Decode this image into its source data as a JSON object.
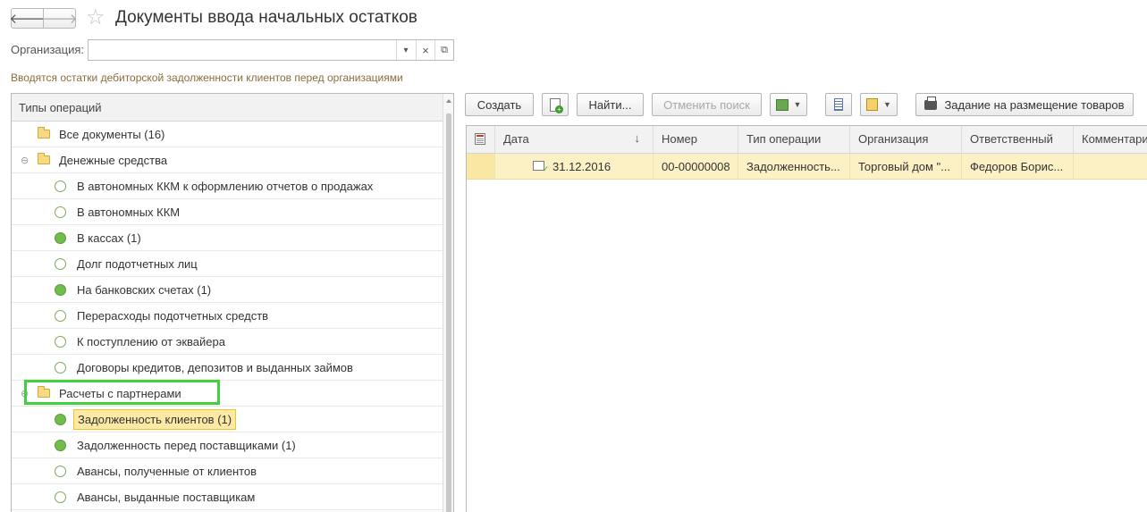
{
  "window": {
    "title": "Документы ввода начальных остатков"
  },
  "filter": {
    "organization_label": "Организация:",
    "organization_value": "",
    "dropdown_glyph": "▾",
    "clear_glyph": "×",
    "open_glyph": "⧉"
  },
  "hint": "Вводятся остатки дебиторской задолженности клиентов перед организациями",
  "tree": {
    "header": "Типы операций",
    "items": [
      {
        "label": "Все документы (16)",
        "kind": "folder",
        "level": 0
      },
      {
        "label": "Денежные средства",
        "kind": "folder",
        "level": 0,
        "expanded": true
      },
      {
        "label": "В автономных ККМ к оформлению отчетов о продажах",
        "kind": "leaf",
        "has_docs": false
      },
      {
        "label": "В автономных ККМ",
        "kind": "leaf",
        "has_docs": false
      },
      {
        "label": "В кассах (1)",
        "kind": "leaf",
        "has_docs": true
      },
      {
        "label": "Долг подотчетных лиц",
        "kind": "leaf",
        "has_docs": false
      },
      {
        "label": "На банковских счетах (1)",
        "kind": "leaf",
        "has_docs": true
      },
      {
        "label": "Перерасходы подотчетных средств",
        "kind": "leaf",
        "has_docs": false
      },
      {
        "label": "К поступлению от эквайера",
        "kind": "leaf",
        "has_docs": false
      },
      {
        "label": "Договоры кредитов, депозитов и выданных займов",
        "kind": "leaf",
        "has_docs": false
      },
      {
        "label": "Расчеты с партнерами",
        "kind": "folder",
        "level": 0,
        "expanded": true,
        "highlighted": true
      },
      {
        "label": "Задолженность клиентов (1)",
        "kind": "leaf",
        "has_docs": true,
        "selected": true
      },
      {
        "label": "Задолженность перед поставщиками (1)",
        "kind": "leaf",
        "has_docs": true
      },
      {
        "label": "Авансы, полученные от клиентов",
        "kind": "leaf",
        "has_docs": false
      },
      {
        "label": "Авансы, выданные поставщикам",
        "kind": "leaf",
        "has_docs": false
      }
    ]
  },
  "toolbar": {
    "create_label": "Создать",
    "find_label": "Найти...",
    "cancel_search_label": "Отменить поиск",
    "placement_task_label": "Задание на размещение товаров"
  },
  "grid": {
    "columns": [
      "Дата",
      "Номер",
      "Тип операции",
      "Организация",
      "Ответственный",
      "Комментари"
    ],
    "sort_glyph": "↓",
    "rows": [
      {
        "date": "31.12.2016",
        "number": "00-00000008",
        "operation_type": "Задолженность...",
        "organization": "Торговый дом \"...",
        "responsible": "Федоров Борис...",
        "comment": ""
      }
    ]
  },
  "colors": {
    "selection_fill": "#fcf1c5",
    "selection_border": "#f2c32f",
    "highlight_box": "#3ed33a",
    "status_filled": "#71bd4c",
    "hint_text": "#8a6d3b"
  }
}
